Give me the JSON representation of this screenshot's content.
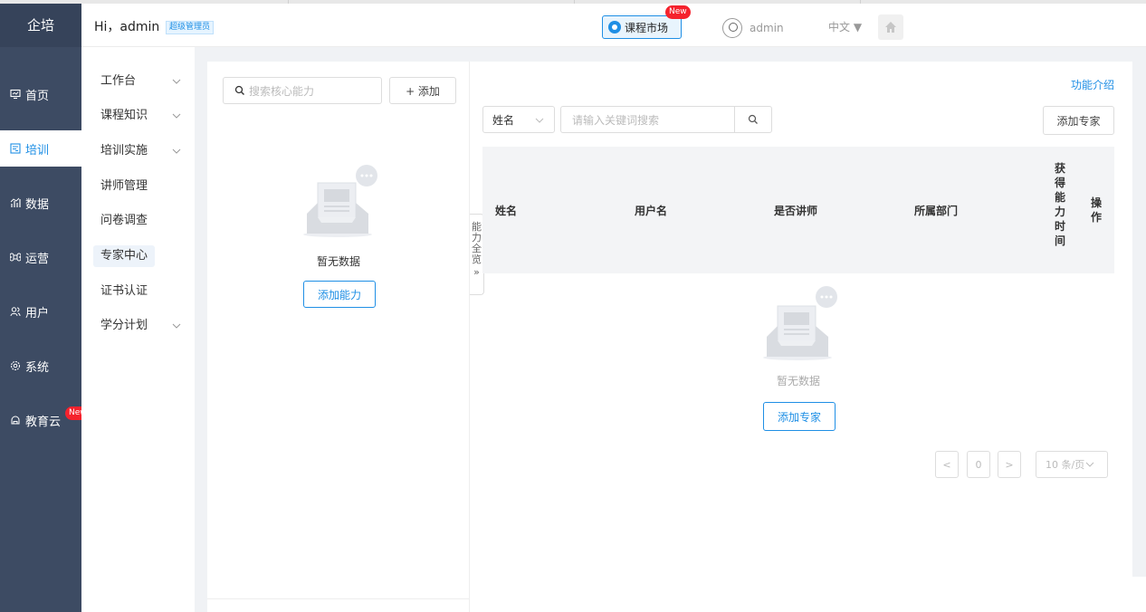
{
  "app": {
    "logo": "企培"
  },
  "header": {
    "greeting": "Hi，admin",
    "role": "超级管理员",
    "market_label": "课程市场",
    "market_badge": "New",
    "username": "admin",
    "language": "中文 ▼"
  },
  "nav": [
    {
      "label": "首页",
      "icon": "monitor-icon"
    },
    {
      "label": "培训",
      "icon": "training-icon",
      "active": true
    },
    {
      "label": "数据",
      "icon": "chart-icon"
    },
    {
      "label": "运营",
      "icon": "command-icon"
    },
    {
      "label": "用户",
      "icon": "users-icon"
    },
    {
      "label": "系统",
      "icon": "gear-icon"
    },
    {
      "label": "教育云",
      "icon": "cloud-icon",
      "badge": "New"
    }
  ],
  "submenu": [
    {
      "label": "工作台",
      "expandable": true
    },
    {
      "label": "课程知识",
      "expandable": true
    },
    {
      "label": "培训实施",
      "expandable": true
    },
    {
      "label": "讲师管理"
    },
    {
      "label": "问卷调查"
    },
    {
      "label": "专家中心",
      "active": true
    },
    {
      "label": "证书认证"
    },
    {
      "label": "学分计划",
      "expandable": true
    }
  ],
  "left_panel": {
    "search_placeholder": "搜索核心能力",
    "add_label": "+ 添加",
    "empty_text": "暂无数据",
    "add_capability_label": "添加能力"
  },
  "capability_handle": {
    "label": "能力全览",
    "arrow": "»"
  },
  "right_panel": {
    "feature_link": "功能介绍",
    "filter_value": "姓名",
    "search_placeholder": "请输入关键词搜索",
    "add_expert_label": "添加专家",
    "columns": [
      "姓名",
      "用户名",
      "是否讲师",
      "所属部门",
      "获得能力时间",
      "操作"
    ],
    "empty_text": "暂无数据",
    "add_expert_empty_label": "添加专家"
  },
  "pagination": {
    "prev": "<",
    "page": "0",
    "next": ">",
    "page_size": "10 条/页"
  }
}
